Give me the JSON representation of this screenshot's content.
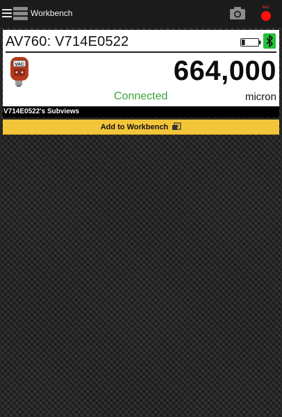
{
  "app": {
    "title": "Workbench"
  },
  "header": {
    "rec_label": "REC"
  },
  "device": {
    "name": "AV760: V714E0522",
    "gauge_label": "VAC",
    "reading": "664,000",
    "status": "Connected",
    "units": "micron",
    "battery_level": 0.2
  },
  "subviews": {
    "title": "V714E0522's Subviews"
  },
  "actions": {
    "add_label": "Add to Workbench"
  },
  "colors": {
    "accent": "#f3c53b",
    "status": "#3aa33a",
    "bluetooth": "#22c33c",
    "record": "#ff1010"
  }
}
